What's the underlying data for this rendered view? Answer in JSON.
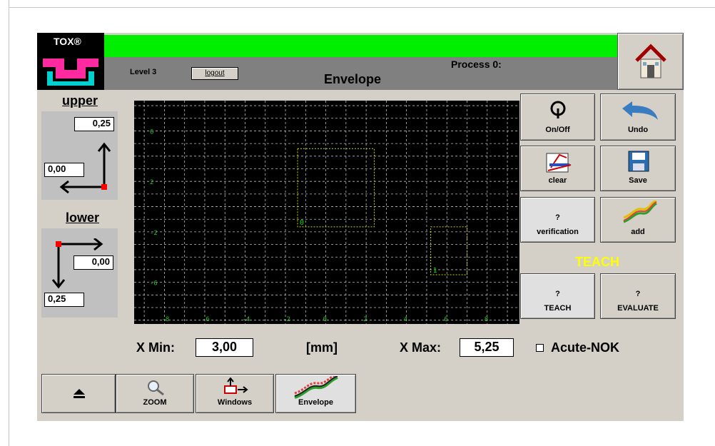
{
  "header": {
    "logo_text": "TOX®",
    "level": "Level 3",
    "logout_label": "logout",
    "title": "Envelope",
    "process": "Process 0:",
    "status_color": "#00ee00"
  },
  "upper": {
    "title": "upper",
    "y_value": "0,25",
    "x_value": "0,00"
  },
  "lower": {
    "title": "lower",
    "x_value": "0,00",
    "y_value": "0,25"
  },
  "buttons": {
    "onoff": "On/Off",
    "undo": "Undo",
    "clear": "clear",
    "save": "Save",
    "verification_mark": "?",
    "verification": "verification",
    "add": "add",
    "teach_title": "TEACH",
    "teach_mark": "?",
    "teach": "TEACH",
    "evaluate_mark": "?",
    "evaluate": "EVALUATE"
  },
  "xrange": {
    "min_label": "X Min:",
    "min_value": "3,00",
    "unit": "[mm]",
    "max_label": "X Max:",
    "max_value": "5,25",
    "acute_label": "Acute-NOK",
    "acute_checked": false
  },
  "bottom_nav": {
    "eject_icon": "eject-icon",
    "zoom": "ZOOM",
    "windows": "Windows",
    "envelope": "Envelope",
    "active": "Envelope"
  },
  "plot": {
    "x_ticks": [
      "-8",
      "-6",
      "-4",
      "-2",
      "0",
      "2",
      "4",
      "6",
      "8"
    ],
    "y_ticks": [
      "6",
      "2",
      "-2",
      "-6"
    ],
    "windows": [
      {
        "label": "0",
        "x": [
          -1.4,
          2.4
        ],
        "y": [
          -1.6,
          4.6
        ]
      },
      {
        "label": "1",
        "x": [
          5.2,
          7.0
        ],
        "y": [
          -5.4,
          -1.6
        ]
      }
    ],
    "grid_color": "#bbbbbb",
    "window_color": "#c8d400",
    "label_color": "#00e000"
  }
}
